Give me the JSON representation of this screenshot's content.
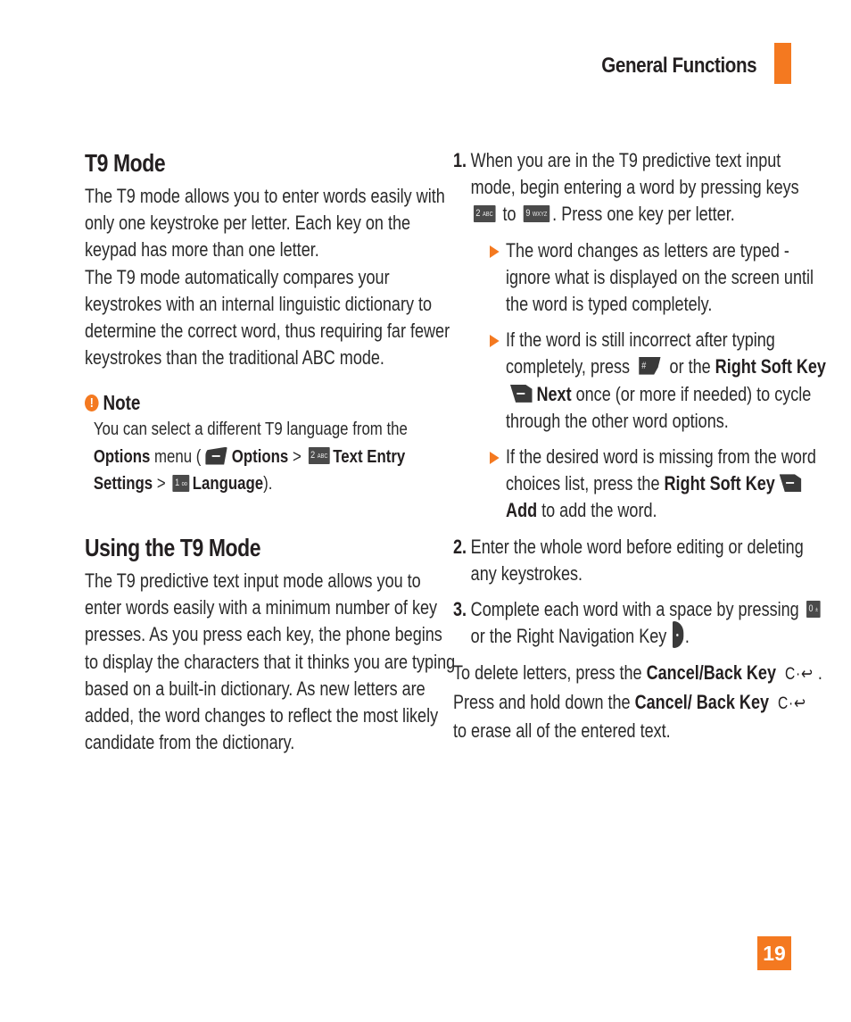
{
  "header": {
    "section_title": "General Functions",
    "accent_color": "#f47920"
  },
  "left": {
    "t9_mode": {
      "heading": "T9 Mode",
      "paragraphs": [
        "The T9 mode allows you to enter words easily with only one keystroke per letter. Each key on the keypad has more than one letter.",
        "The T9 mode automatically compares your keystrokes with an internal linguistic dictionary to determine the correct word, thus requiring far fewer keystrokes than the traditional ABC mode."
      ]
    },
    "note": {
      "icon": "exclamation-circle-icon",
      "heading": "Note",
      "text_1": "You can select a different T9 language from the ",
      "bold_options": "Options",
      "text_2": " menu (",
      "left_softkey_icon": "left-soft-key-icon",
      "bold_options_2": "Options",
      "gt_1": " > ",
      "key_2": {
        "num": "2",
        "letters": "ABC"
      },
      "bold_text_entry": "Text Entry Settings",
      "gt_2": " > ",
      "key_1": {
        "num": "1",
        "letters": "oo"
      },
      "bold_language": "Language",
      "close": ")."
    },
    "using": {
      "heading": "Using the T9 Mode",
      "paragraph": "The T9 predictive text input mode allows you to enter words easily with a minimum number of key presses. As you press each key, the phone begins to display the characters that it thinks you are typing based on a built-in dictionary. As new letters are added, the word changes to reflect the most likely candidate from the dictionary."
    }
  },
  "right": {
    "steps": [
      {
        "num": "1.",
        "text_a": "When you are in the T9 predictive text input mode, begin entering a word by pressing keys",
        "key_from": {
          "num": "2",
          "letters": "ABC"
        },
        "text_b": "to",
        "key_to": {
          "num": "9",
          "letters": "WXYZ"
        },
        "text_c": ". Press one key per letter.",
        "bullets": [
          {
            "text": "The word changes as letters are typed - ignore what is displayed on the screen until the word is typed completely."
          },
          {
            "text_a": "If the word is still incorrect after typing completely, press",
            "hash_key": "#",
            "text_b": "or the",
            "bold_a": "Right Soft Key",
            "bold_b": "Next",
            "text_c": "once (or more if needed) to cycle through the other word options."
          },
          {
            "text_a": "If the desired word is missing from the word choices list, press the",
            "bold_a": "Right Soft Key",
            "bold_b": "Add",
            "text_c": "to add the word."
          }
        ]
      },
      {
        "num": "2.",
        "text": "Enter the whole word before editing or deleting any keystrokes."
      },
      {
        "num": "3.",
        "text_a": "Complete each word with a space by pressing",
        "key_0": {
          "num": "0",
          "letters": "±"
        },
        "text_b": "or the Right Navigation Key",
        "text_c": "."
      }
    ],
    "delete": {
      "text_a": "To delete letters, press the",
      "bold_a": "Cancel/Back Key",
      "back_glyph": "C·↩",
      "text_b": ". Press and hold down the",
      "bold_b": "Cancel/ Back Key",
      "text_c": "to erase all of the entered text."
    }
  },
  "footer": {
    "page_number": "19"
  }
}
